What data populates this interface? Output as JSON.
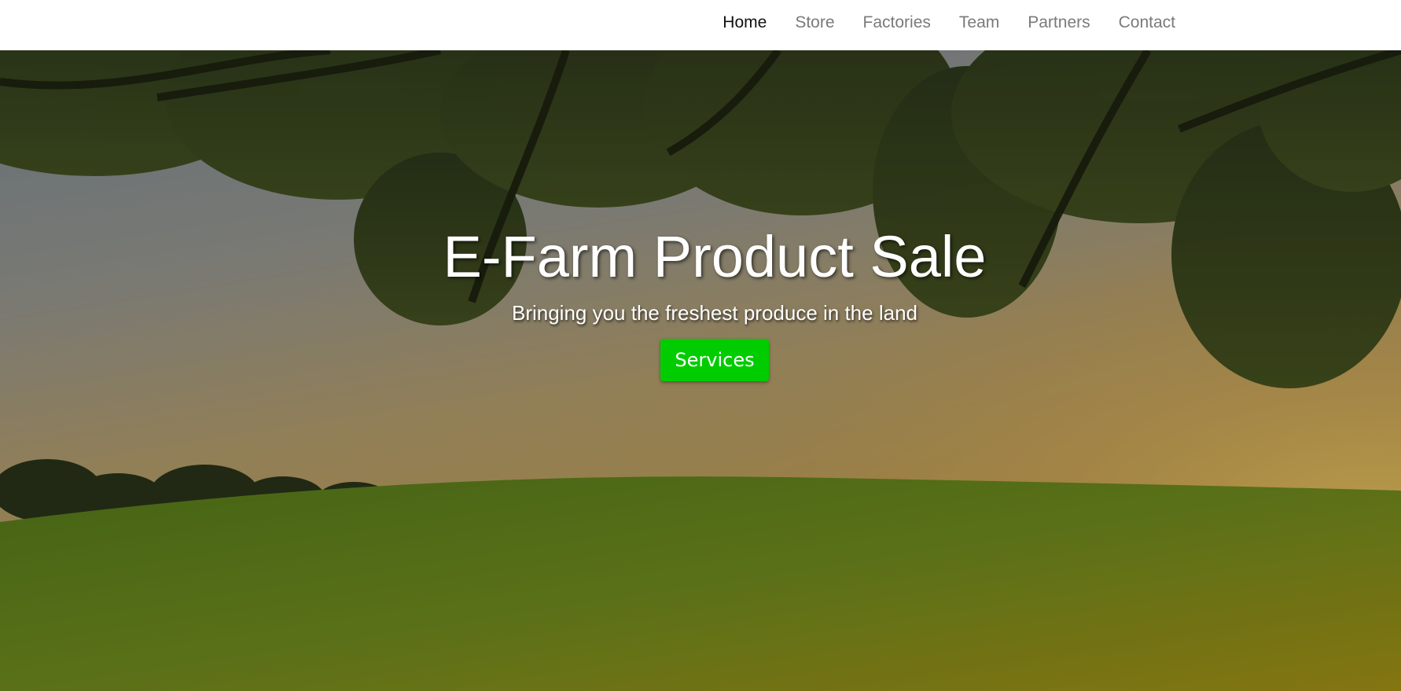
{
  "nav": {
    "items": [
      {
        "label": "Home",
        "active": true
      },
      {
        "label": "Store",
        "active": false
      },
      {
        "label": "Factories",
        "active": false
      },
      {
        "label": "Team",
        "active": false
      },
      {
        "label": "Partners",
        "active": false
      },
      {
        "label": "Contact",
        "active": false
      }
    ]
  },
  "hero": {
    "title": "E-Farm Product Sale",
    "subtitle": "Bringing you the freshest produce in the land",
    "button_label": "Services",
    "button_color": "#00cc00",
    "background": "landscape-sunset-field-photo"
  }
}
